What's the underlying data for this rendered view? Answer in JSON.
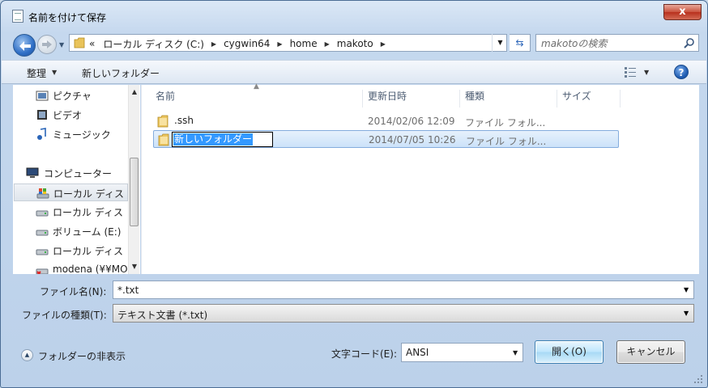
{
  "window": {
    "title": "名前を付けて保存",
    "close_label": "x"
  },
  "address": {
    "overflow_chevron": "«",
    "crumbs": [
      "ローカル ディスク (C:)",
      "cygwin64",
      "home",
      "makoto"
    ]
  },
  "search": {
    "placeholder": "makotoの検索"
  },
  "toolbar": {
    "organize_label": "整理",
    "new_folder_label": "新しいフォルダー",
    "help_label": "?"
  },
  "nav": {
    "items": [
      {
        "label": "ピクチャ",
        "icon": "pictures-icon"
      },
      {
        "label": "ビデオ",
        "icon": "videos-icon"
      },
      {
        "label": "ミュージック",
        "icon": "music-icon"
      },
      {
        "label": "コンピューター",
        "icon": "computer-icon"
      },
      {
        "label": "ローカル ディス",
        "icon": "system-drive-icon"
      },
      {
        "label": "ローカル ディス",
        "icon": "drive-icon"
      },
      {
        "label": "ボリューム (E:)",
        "icon": "drive-icon"
      },
      {
        "label": "ローカル ディス",
        "icon": "drive-icon"
      },
      {
        "label": "modena (¥¥MO",
        "icon": "network-drive-icon"
      }
    ]
  },
  "file_list": {
    "columns": [
      "名前",
      "更新日時",
      "種類",
      "サイズ"
    ],
    "rows": [
      {
        "name": ".ssh",
        "date": "2014/02/06 12:09",
        "type": "ファイル フォル..."
      },
      {
        "name": "新しいフォルダー",
        "date": "2014/07/05 10:26",
        "type": "ファイル フォル..."
      }
    ]
  },
  "form": {
    "filename_label": "ファイル名(N):",
    "filename_value": "*.txt",
    "filetype_label": "ファイルの種類(T):",
    "filetype_value": "テキスト文書 (*.txt)",
    "hide_folders_label": "フォルダーの非表示",
    "encoding_label": "文字コード(E):",
    "encoding_value": "ANSI",
    "open_label": "開く(O)",
    "cancel_label": "キャンセル"
  },
  "colors": {
    "selection": "#3399ff",
    "accent": "#2f6fc6",
    "close": "#c9513c"
  }
}
